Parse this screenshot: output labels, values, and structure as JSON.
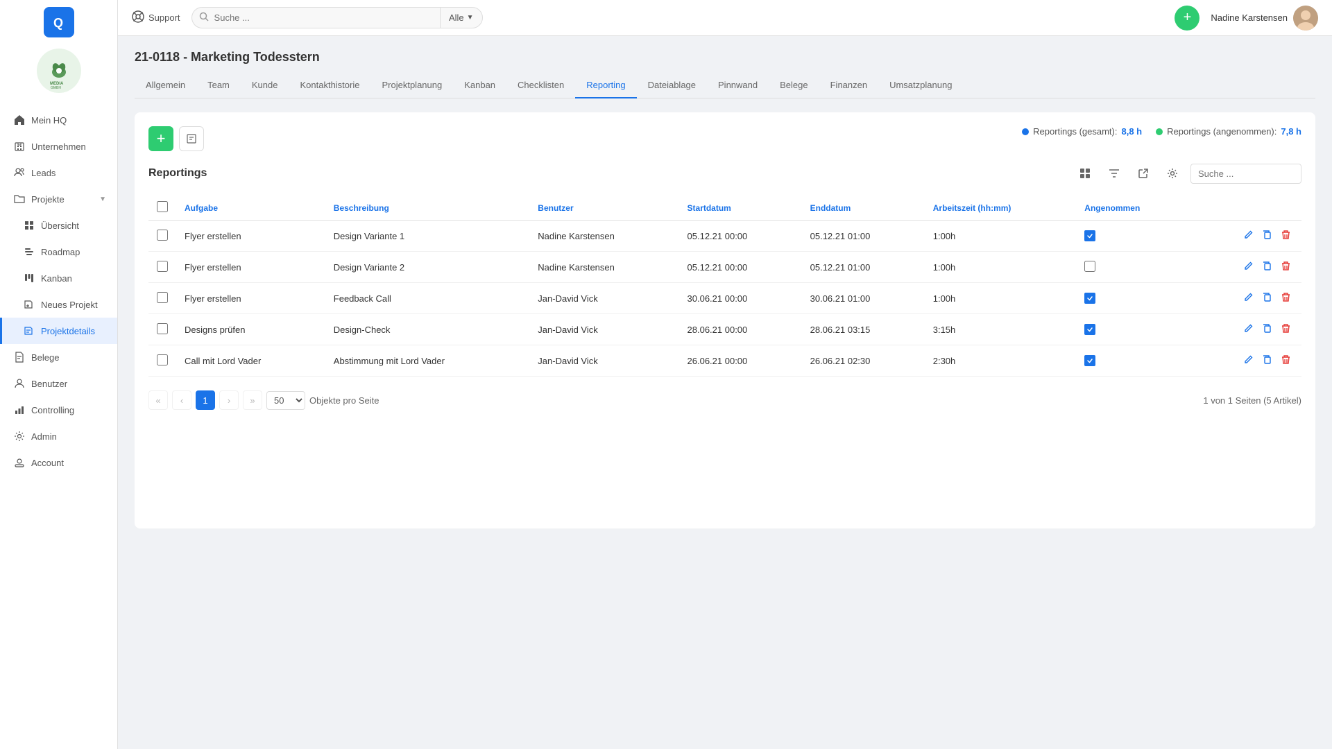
{
  "app": {
    "logo_text": "Q",
    "support_label": "Support"
  },
  "topbar": {
    "search_placeholder": "Suche ...",
    "search_filter": "Alle",
    "add_btn_label": "+",
    "user_name": "Nadine Karstensen"
  },
  "sidebar": {
    "items": [
      {
        "id": "mein-hq",
        "label": "Mein HQ",
        "icon": "home"
      },
      {
        "id": "unternehmen",
        "label": "Unternehmen",
        "icon": "building"
      },
      {
        "id": "leads",
        "label": "Leads",
        "icon": "users"
      },
      {
        "id": "projekte",
        "label": "Projekte",
        "icon": "folder",
        "has_arrow": true
      },
      {
        "id": "uebersicht",
        "label": "Übersicht",
        "icon": "grid",
        "sub": true
      },
      {
        "id": "roadmap",
        "label": "Roadmap",
        "icon": "map",
        "sub": true
      },
      {
        "id": "kanban",
        "label": "Kanban",
        "icon": "kanban",
        "sub": true
      },
      {
        "id": "neues-projekt",
        "label": "Neues Projekt",
        "icon": "plus",
        "sub": true
      },
      {
        "id": "projektdetails",
        "label": "Projektdetails",
        "icon": "detail",
        "sub": true,
        "active": true
      },
      {
        "id": "belege",
        "label": "Belege",
        "icon": "receipt"
      },
      {
        "id": "benutzer",
        "label": "Benutzer",
        "icon": "person"
      },
      {
        "id": "controlling",
        "label": "Controlling",
        "icon": "chart"
      },
      {
        "id": "admin",
        "label": "Admin",
        "icon": "gear"
      },
      {
        "id": "account",
        "label": "Account",
        "icon": "account"
      }
    ]
  },
  "project": {
    "title": "21-0118 - Marketing Todesstern",
    "tabs": [
      {
        "id": "allgemein",
        "label": "Allgemein"
      },
      {
        "id": "team",
        "label": "Team"
      },
      {
        "id": "kunde",
        "label": "Kunde"
      },
      {
        "id": "kontakthistorie",
        "label": "Kontakthistorie"
      },
      {
        "id": "projektplanung",
        "label": "Projektplanung"
      },
      {
        "id": "kanban",
        "label": "Kanban"
      },
      {
        "id": "checklisten",
        "label": "Checklisten"
      },
      {
        "id": "reporting",
        "label": "Reporting",
        "active": true
      },
      {
        "id": "dateiablage",
        "label": "Dateiablage"
      },
      {
        "id": "pinnwand",
        "label": "Pinnwand"
      },
      {
        "id": "belege",
        "label": "Belege"
      },
      {
        "id": "finanzen",
        "label": "Finanzen"
      },
      {
        "id": "umsatzplanung",
        "label": "Umsatzplanung"
      }
    ]
  },
  "reporting": {
    "title": "Reportings",
    "search_placeholder": "Suche ...",
    "stats": {
      "total_label": "Reportings (gesamt):",
      "total_value": "8,8 h",
      "accepted_label": "Reportings (angenommen):",
      "accepted_value": "7,8 h"
    },
    "columns": [
      {
        "id": "aufgabe",
        "label": "Aufgabe"
      },
      {
        "id": "beschreibung",
        "label": "Beschreibung"
      },
      {
        "id": "benutzer",
        "label": "Benutzer"
      },
      {
        "id": "startdatum",
        "label": "Startdatum"
      },
      {
        "id": "enddatum",
        "label": "Enddatum"
      },
      {
        "id": "arbeitszeit",
        "label": "Arbeitszeit (hh:mm)"
      },
      {
        "id": "angenommen",
        "label": "Angenommen"
      }
    ],
    "rows": [
      {
        "id": 1,
        "aufgabe": "Flyer erstellen",
        "beschreibung": "Design Variante 1",
        "benutzer": "Nadine Karstensen",
        "startdatum": "05.12.21 00:00",
        "enddatum": "05.12.21 01:00",
        "arbeitszeit": "1:00h",
        "angenommen": true,
        "checked": false
      },
      {
        "id": 2,
        "aufgabe": "Flyer erstellen",
        "beschreibung": "Design Variante 2",
        "benutzer": "Nadine Karstensen",
        "startdatum": "05.12.21 00:00",
        "enddatum": "05.12.21 01:00",
        "arbeitszeit": "1:00h",
        "angenommen": false,
        "checked": false
      },
      {
        "id": 3,
        "aufgabe": "Flyer erstellen",
        "beschreibung": "Feedback Call",
        "benutzer": "Jan-David Vick",
        "startdatum": "30.06.21 00:00",
        "enddatum": "30.06.21 01:00",
        "arbeitszeit": "1:00h",
        "angenommen": true,
        "checked": false
      },
      {
        "id": 4,
        "aufgabe": "Designs prüfen",
        "beschreibung": "Design-Check",
        "benutzer": "Jan-David Vick",
        "startdatum": "28.06.21 00:00",
        "enddatum": "28.06.21 03:15",
        "arbeitszeit": "3:15h",
        "angenommen": true,
        "checked": false
      },
      {
        "id": 5,
        "aufgabe": "Call mit Lord Vader",
        "beschreibung": "Abstimmung mit Lord Vader",
        "benutzer": "Jan-David Vick",
        "startdatum": "26.06.21 00:00",
        "enddatum": "26.06.21 02:30",
        "arbeitszeit": "2:30h",
        "angenommen": true,
        "checked": false
      }
    ],
    "pagination": {
      "current_page": 1,
      "per_page": "50",
      "per_page_label": "Objekte pro Seite",
      "info": "1 von 1 Seiten (5 Artikel)"
    }
  }
}
